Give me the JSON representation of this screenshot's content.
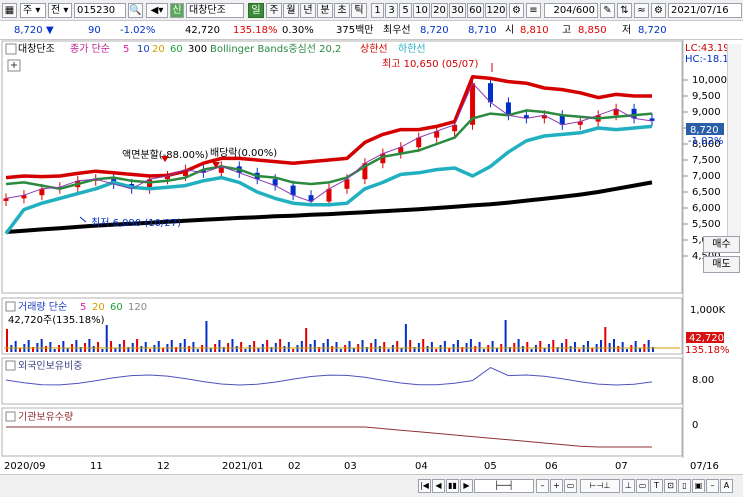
{
  "toolbar1": {
    "market": "주",
    "market2": "전",
    "code": "015230",
    "sin_label": "신",
    "name": "대창단조",
    "periods": [
      "일",
      "주",
      "월",
      "년",
      "분",
      "초",
      "틱"
    ],
    "active_period": "일",
    "intervals": [
      "1",
      "3",
      "5",
      "10",
      "20",
      "30",
      "60",
      "120"
    ],
    "count": "204/600",
    "date": "2021/07/16"
  },
  "toolbar2": {
    "price": "8,720",
    "change": "90",
    "change_pct": "-1.02%",
    "volume": "42,720",
    "vol_pct": "135.18%",
    "turnover_pct": "0.30%",
    "amount": "375백만",
    "best_ask_label": "최우선",
    "best_ask": "8,720",
    "best_bid": "8,710",
    "open_label": "시",
    "open": "8,810",
    "high_label": "고",
    "high": "8,850",
    "low_label": "저",
    "low": "8,720"
  },
  "legend": {
    "name": "대창단조",
    "ma_label": "종가 단순",
    "ma5": "5",
    "ma10": "10",
    "ma20": "20",
    "ma60": "60",
    "ma300": "300",
    "bb": "Bollinger Bands중심선 20,2",
    "upper": "상한선",
    "lower": "하한선"
  },
  "annotations": {
    "high": "최고 10,650 (05/07)",
    "low": "최저 6,090 (10/27)",
    "split": "액면분할(-88.00%)",
    "dividend": "배당락(0.00%)"
  },
  "price_axis": {
    "lc": "LC:43.19",
    "hc": "HC:-18.12",
    "labels": [
      "10,000",
      "9,500",
      "9,000",
      "8,500",
      "8,000",
      "7,500",
      "7,000",
      "6,500",
      "6,000",
      "5,500",
      "5,000",
      "4,500"
    ],
    "current": "8,720",
    "current_pct": "-1.02%"
  },
  "buttons": {
    "buy": "매수",
    "sell": "매도"
  },
  "volume_pane": {
    "title": "거래량 단순",
    "ma5": "5",
    "ma20": "20",
    "ma60": "60",
    "ma120": "120",
    "value": "42,720주(135.18%)",
    "axis_label": "1,000K",
    "tag": "42,720",
    "tag_pct": "135.18%"
  },
  "foreign_pane": {
    "title": "외국인보유비중",
    "axis_label": "8.00"
  },
  "inst_pane": {
    "title": "기관보유수량",
    "axis_label": "0"
  },
  "time_axis": [
    "2020/09",
    "11",
    "12",
    "2021/01",
    "02",
    "03",
    "04",
    "05",
    "06",
    "07",
    "07/16"
  ],
  "colors": {
    "up": "#e00000",
    "down": "#0030c8",
    "bb_upper": "#d40000",
    "bb_lower": "#20b0c0",
    "bb_mid": "#2a8a40",
    "ma300": "#000000",
    "sel": "#3a8a3a"
  },
  "chart_data": {
    "type": "candlestick",
    "period": "daily",
    "x_range": [
      "2020-09-01",
      "2021-07-16"
    ],
    "ylim": [
      4500,
      10650
    ],
    "bb_upper": [
      6950,
      7000,
      6980,
      7000,
      7080,
      7150,
      7100,
      7050,
      7000,
      7020,
      7150,
      7400,
      7550,
      7550,
      7500,
      7450,
      7400,
      7450,
      7500,
      7550,
      8050,
      8300,
      8450,
      8450,
      8550,
      8700,
      10100,
      10050,
      9950,
      9900,
      9750,
      9700,
      9600,
      9450,
      9550,
      9500,
      9500
    ],
    "bb_mid": [
      6750,
      6800,
      6700,
      6600,
      6750,
      6900,
      6950,
      6850,
      6800,
      6850,
      6950,
      7200,
      7300,
      7200,
      7000,
      6950,
      6800,
      6750,
      6800,
      6950,
      7300,
      7600,
      7700,
      7800,
      8000,
      8200,
      8800,
      8950,
      8900,
      9050,
      9000,
      8900,
      8850,
      8800,
      8850,
      8900,
      8950
    ],
    "bb_lower": [
      5200,
      5950,
      6150,
      6300,
      6450,
      6600,
      6800,
      6650,
      6600,
      6650,
      6700,
      6850,
      6950,
      6800,
      6500,
      6300,
      6150,
      6100,
      6100,
      6150,
      6600,
      6800,
      7050,
      7100,
      7200,
      7250,
      7000,
      7300,
      7750,
      8100,
      8250,
      8300,
      8350,
      8500,
      8450,
      8500,
      8550
    ],
    "ma300": [
      5250,
      5290,
      5330,
      5370,
      5410,
      5450,
      5480,
      5510,
      5540,
      5570,
      5600,
      5630,
      5660,
      5690,
      5710,
      5740,
      5760,
      5790,
      5810,
      5840,
      5870,
      5900,
      5930,
      5960,
      6000,
      6040,
      6080,
      6120,
      6170,
      6230,
      6290,
      6350,
      6420,
      6500,
      6600,
      6700,
      6800
    ],
    "close": [
      6300,
      6400,
      6600,
      6650,
      6850,
      6900,
      6750,
      6600,
      6900,
      7000,
      7200,
      7100,
      7300,
      7100,
      6900,
      6700,
      6400,
      6200,
      6600,
      6900,
      7400,
      7700,
      7900,
      8200,
      8400,
      8600,
      9900,
      9300,
      8900,
      8800,
      8900,
      8600,
      8700,
      8900,
      9100,
      8800,
      8720
    ],
    "annotations": {
      "high": {
        "value": 10650,
        "date": "05/07"
      },
      "low": {
        "value": 6090,
        "date": "10/27"
      }
    }
  }
}
